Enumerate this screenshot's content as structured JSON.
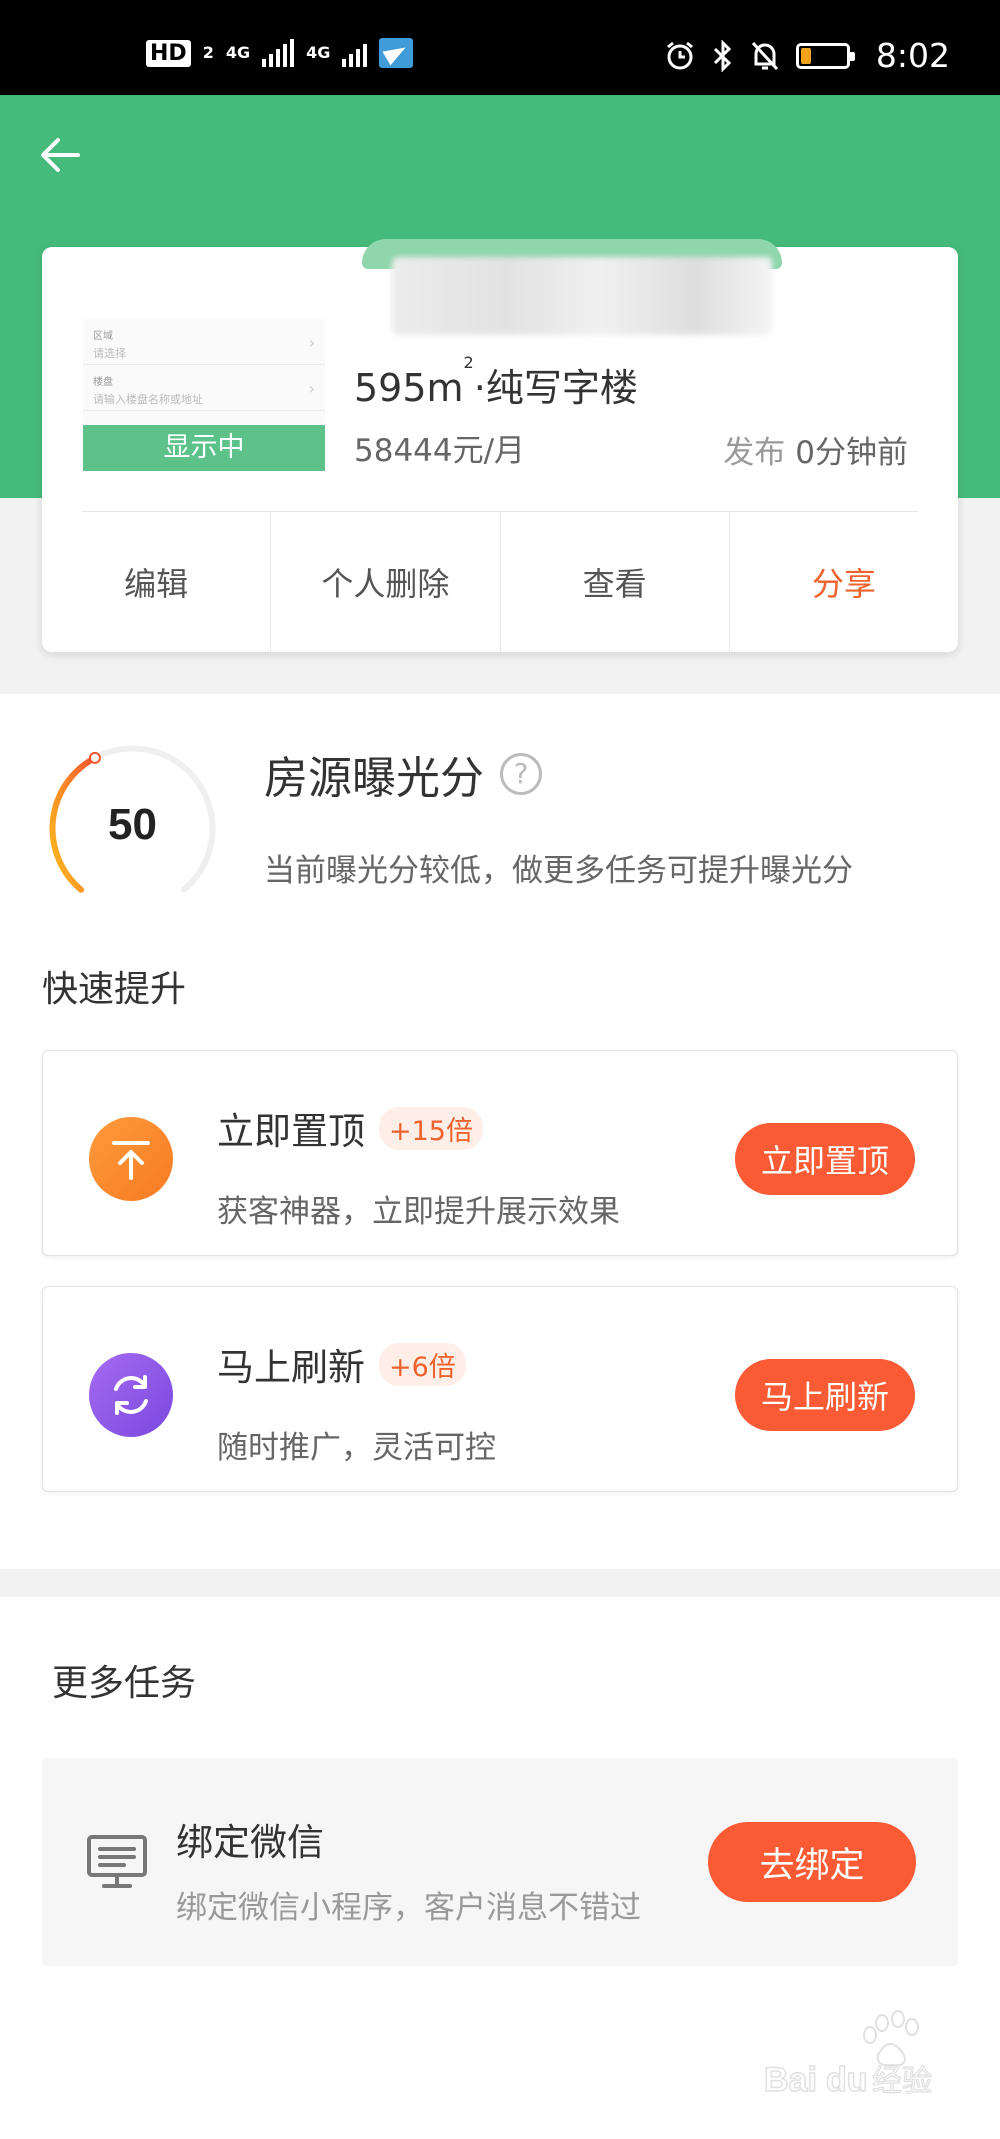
{
  "status_bar": {
    "hd_label": "HD",
    "hd_sub": "2",
    "net1": "4G",
    "net2": "4G",
    "time": "8:02",
    "icons": [
      "alarm-icon",
      "bluetooth-icon",
      "bell-off-icon",
      "battery-icon"
    ]
  },
  "nav": {
    "back_icon": "arrow-left-icon"
  },
  "listing": {
    "thumb_rows": [
      {
        "label": "区域",
        "value": "请选择"
      },
      {
        "label": "楼盘",
        "value": "请输入楼盘名称或地址"
      }
    ],
    "status": "显示中",
    "area": "595m",
    "area_sup": "2",
    "type": "·纯写字楼",
    "price": "58444元/月",
    "publish_label": "发布",
    "publish_time": "0分钟前",
    "actions": [
      "编辑",
      "个人删除",
      "查看",
      "分享"
    ]
  },
  "score": {
    "value": "50",
    "fraction": 0.5,
    "title": "房源曝光分",
    "help": "?",
    "desc": "当前曝光分较低，做更多任务可提升曝光分"
  },
  "quick_title": "快速提升",
  "tasks": [
    {
      "name": "立即置顶",
      "badge": "+15倍",
      "desc": "获客神器，立即提升展示效果",
      "button": "立即置顶",
      "icon": "arrow-up-to-top-icon",
      "color": "#f7862f"
    },
    {
      "name": "马上刷新",
      "badge": "+6倍",
      "desc": "随时推广，灵活可控",
      "button": "马上刷新",
      "icon": "refresh-icon",
      "color": "#8b57e6"
    }
  ],
  "more_title": "更多任务",
  "wechat": {
    "name": "绑定微信",
    "desc": "绑定微信小程序，客户消息不错过",
    "button": "去绑定",
    "icon": "monitor-icon"
  },
  "watermark": {
    "text": "Baidu经验"
  },
  "colors": {
    "primary_green": "#45bb7b",
    "accent_orange": "#fa5a34",
    "share_orange": "#f0622d"
  }
}
